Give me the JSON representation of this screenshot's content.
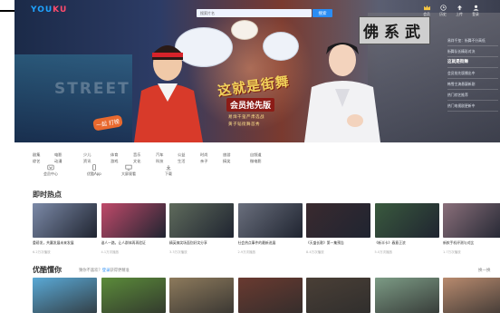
{
  "app": {
    "logo": "YOUKU",
    "search_placeholder": "搜索片名",
    "search_button": "搜索",
    "top_icons": [
      {
        "name": "vip-crown-icon",
        "label": "会员"
      },
      {
        "name": "history-icon",
        "label": "历史"
      },
      {
        "name": "upload-icon",
        "label": "上传"
      },
      {
        "name": "user-icon",
        "label": "登录"
      }
    ]
  },
  "hero": {
    "background_text": "STREET",
    "board_text": "佛系武",
    "title": "这就是街舞",
    "subtitle": "会员抢先版",
    "tagline_1": "易烊千玺严肃选战",
    "tagline_2": "黄子韬街舞首秀",
    "badge": "一起\n打榜",
    "side_items": [
      {
        "text": "易烊千玺：街舞不分高低",
        "highlight": false
      },
      {
        "text": "街舞队长精彩对决",
        "highlight": false
      },
      {
        "text": "这就是街舞",
        "highlight": true
      },
      {
        "text": "会员抢先版播出中",
        "highlight": false
      },
      {
        "text": "韩雪主演悬疑新剧",
        "highlight": false
      },
      {
        "text": "热门综艺推荐",
        "highlight": false
      },
      {
        "text": "热门电视剧更新中",
        "highlight": false
      }
    ]
  },
  "nav": {
    "columns": [
      [
        "剧集",
        "综艺"
      ],
      [
        "电影",
        "动漫"
      ],
      [
        "少儿",
        "资讯"
      ],
      [
        "体育",
        "游戏"
      ],
      [
        "音乐",
        "文化"
      ],
      [
        "汽车",
        "科技"
      ],
      [
        "公益",
        "生活"
      ],
      [
        "时尚",
        "亲子"
      ],
      [
        "旅游",
        "搞笑"
      ],
      [
        "自频道",
        "微电影"
      ]
    ],
    "buttons": [
      {
        "name": "vip-icon",
        "label": "会员中心"
      },
      {
        "name": "app-icon",
        "label": "优酷App"
      },
      {
        "name": "tv-icon",
        "label": "大屏观看"
      },
      {
        "name": "download-icon",
        "label": "下载"
      }
    ]
  },
  "sections": {
    "hot": {
      "title": "即时热点"
    },
    "guess": {
      "title": "优酷懂你",
      "sub_prefix": "猜你不喜欢？",
      "sub_link": "登录",
      "sub_suffix": "获得更精准",
      "more": "换一换"
    }
  },
  "hot_items": [
    {
      "caption": "重磅发，共赢发展未来发展",
      "meta": "6.2万次播放",
      "color": "#7c8aa8"
    },
    {
      "caption": "谁人一路，让人群体再再验证",
      "meta": "4.1万次播放",
      "color": "#c04a6a"
    },
    {
      "caption": "精英搞笑场面别好笑分享",
      "meta": "3.3万次播放",
      "color": "#5f6b5c"
    },
    {
      "caption": "社会热点事件的最新进展",
      "meta": "2.9万次播放",
      "color": "#6a6f7d"
    },
    {
      "caption": "《天盛长歌》第一集预告",
      "meta": "8.4万次播放",
      "color": "#3a2a2f"
    },
    {
      "caption": "《新半卡》春意正浓",
      "meta": "5.0万次播放",
      "color": "#3a5a3e"
    },
    {
      "caption": "新款手机评测与对比",
      "meta": "1.7万次播放",
      "color": "#8a6f7a"
    }
  ],
  "guess_items": [
    {
      "color": "#5aa9d6"
    },
    {
      "color": "#5b8b3a"
    },
    {
      "color": "#8d7a5c"
    },
    {
      "color": "#6a3a30"
    },
    {
      "color": "#4a3f36"
    },
    {
      "color": "#7c9b85"
    },
    {
      "color": "#b88a6e"
    }
  ],
  "theme": {
    "accent": "#2a8df4",
    "brand_blue": "#1fa3ff",
    "brand_pink": "#ff4b6c"
  }
}
